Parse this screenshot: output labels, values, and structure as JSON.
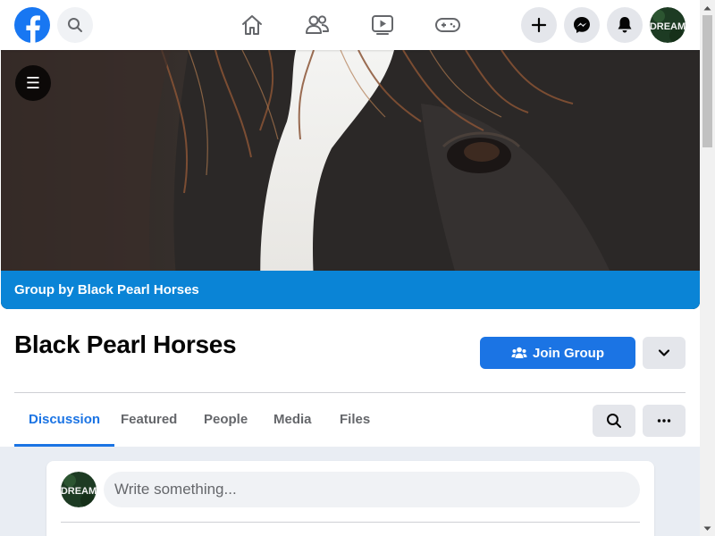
{
  "topbar": {
    "logo_icon": "facebook-logo-icon",
    "search_icon": "search-icon",
    "nav_icons": [
      "home-icon",
      "friends-icon",
      "watch-icon",
      "gaming-icon"
    ],
    "right_icons": [
      "plus-icon",
      "messenger-icon",
      "notifications-icon"
    ],
    "avatar_text": "DREAM"
  },
  "cover": {
    "menu_icon": "hamburger-menu-icon",
    "banner_text": "Group by Black Pearl Horses",
    "banner_color": "#0a84d6"
  },
  "group": {
    "title": "Black Pearl Horses",
    "join_label": "Join Group",
    "join_icon": "people-icon",
    "more_icon": "chevron-down-icon"
  },
  "tabs": [
    {
      "label": "Discussion",
      "active": true
    },
    {
      "label": "Featured",
      "active": false
    },
    {
      "label": "People",
      "active": false
    },
    {
      "label": "Media",
      "active": false
    },
    {
      "label": "Files",
      "active": false
    }
  ],
  "tools": {
    "search_icon": "search-icon",
    "more_icon": "more-horizontal-icon"
  },
  "composer": {
    "placeholder": "Write something...",
    "avatar_text": "DREAM"
  },
  "colors": {
    "accent": "#1b74e4",
    "background": "#f0f2f5",
    "secondary_text": "#65676b"
  }
}
